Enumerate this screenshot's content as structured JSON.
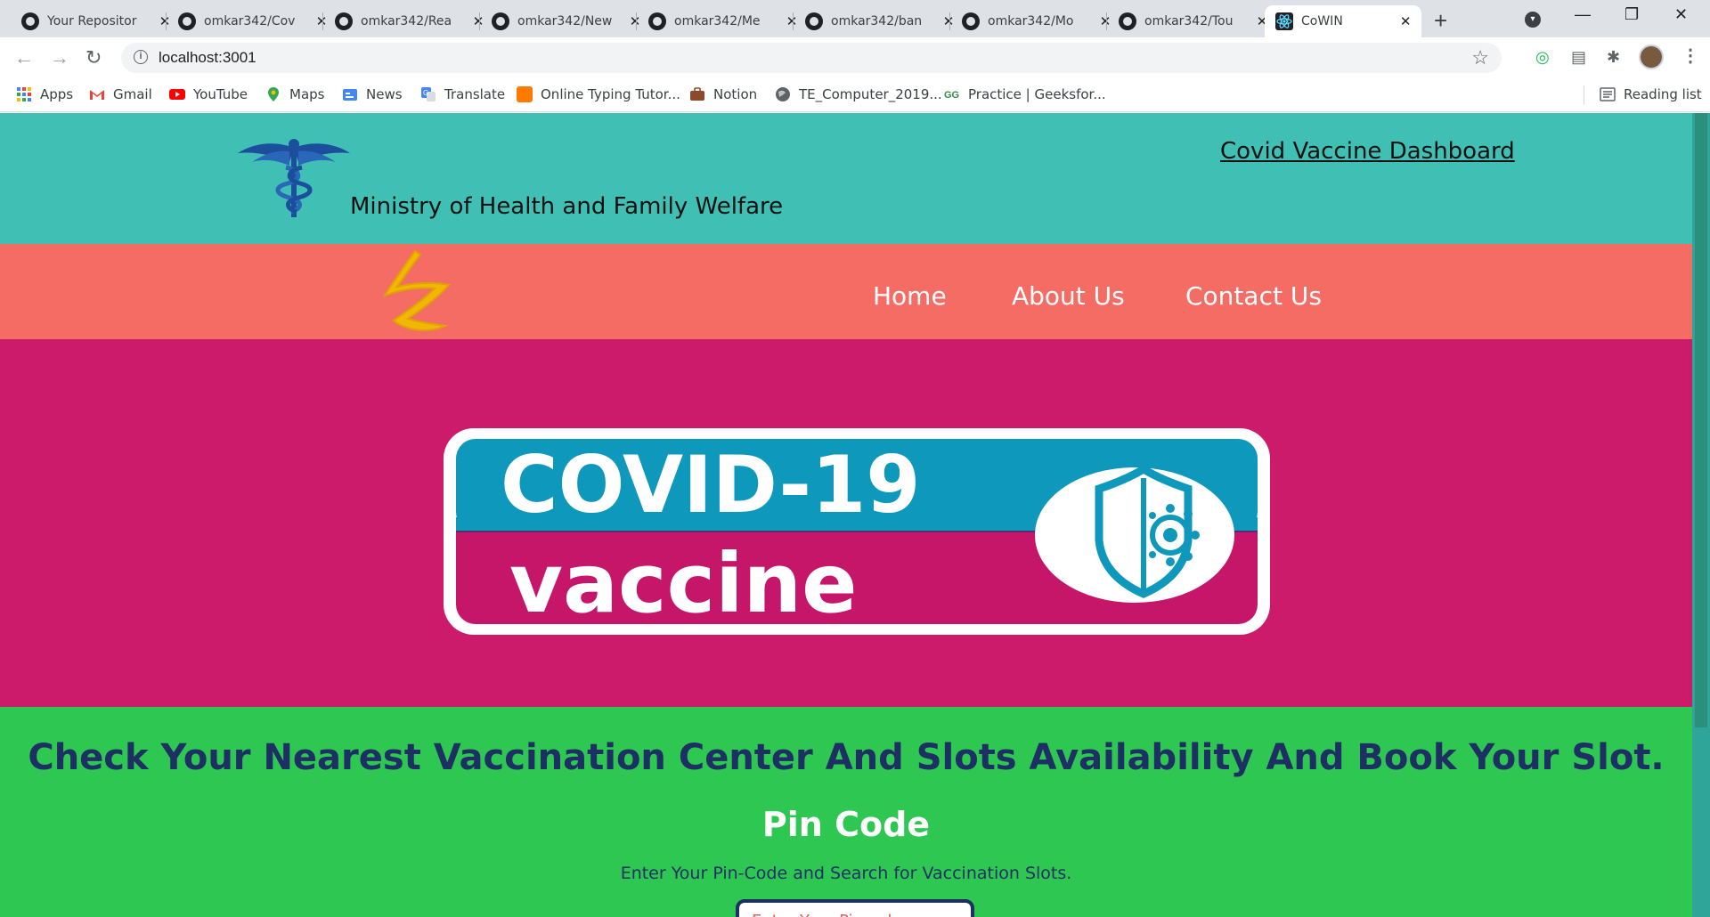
{
  "browser": {
    "tabs": [
      {
        "title": "Your Repositor",
        "icon": "github-icon"
      },
      {
        "title": "omkar342/Cov",
        "icon": "github-icon"
      },
      {
        "title": "omkar342/Rea",
        "icon": "github-icon"
      },
      {
        "title": "omkar342/New",
        "icon": "github-icon"
      },
      {
        "title": "omkar342/Me",
        "icon": "github-icon"
      },
      {
        "title": "omkar342/ban",
        "icon": "github-icon"
      },
      {
        "title": "omkar342/Mo",
        "icon": "github-icon"
      },
      {
        "title": "omkar342/Tou",
        "icon": "github-icon"
      },
      {
        "title": "CoWIN",
        "icon": "react-icon",
        "active": true
      }
    ],
    "url": "localhost:3001",
    "bookmarks": [
      {
        "label": "Apps",
        "icon": "apps-grid-icon"
      },
      {
        "label": "Gmail",
        "icon": "gmail-icon"
      },
      {
        "label": "YouTube",
        "icon": "youtube-icon"
      },
      {
        "label": "Maps",
        "icon": "maps-pin-icon"
      },
      {
        "label": "News",
        "icon": "google-news-icon"
      },
      {
        "label": "Translate",
        "icon": "translate-icon"
      },
      {
        "label": "Online Typing Tutor...",
        "icon": "orange-square-icon"
      },
      {
        "label": "Notion",
        "icon": "briefcase-icon"
      },
      {
        "label": "TE_Computer_2019...",
        "icon": "globe-icon"
      },
      {
        "label": "Practice | Geeksfor...",
        "icon": "geeksforgeeks-icon"
      }
    ],
    "reading_list": "Reading list",
    "colors": {
      "tabbar": "#dee1e6",
      "omnibox": "#f1f3f4"
    }
  },
  "header": {
    "ministry": "Ministry of Health and Family Welfare",
    "dashboard_link": "Covid Vaccine Dashboard",
    "logo_icon": "caduceus-icon",
    "bg": "#40c0b4"
  },
  "nav": {
    "logo_icon": "astrazeneca-logo",
    "links": [
      "Home",
      "About Us",
      "Contact Us"
    ],
    "bg": "#f46c64"
  },
  "hero": {
    "badge_line1": "COVID-19",
    "badge_line2": "vaccine",
    "badge_icon": "shield-virus-icon",
    "bg": "#cc1b6a"
  },
  "booking": {
    "heading": "Check Your Nearest Vaccination Center And Slots Availability And Book Your Slot.",
    "pin_title": "Pin Code",
    "pin_description": "Enter Your Pin-Code and Search for Vaccination Slots.",
    "pin_placeholder": "Enter Your Pincode",
    "bg": "#2ec752",
    "text_color": "#1e3063"
  }
}
